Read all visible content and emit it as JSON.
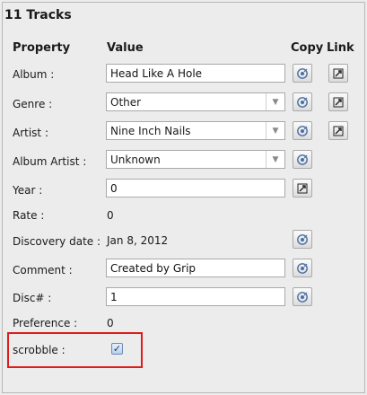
{
  "panel": {
    "title": "11 Tracks"
  },
  "headers": {
    "property": "Property",
    "value": "Value",
    "copy": "Copy",
    "link": "Link"
  },
  "fields": {
    "album": {
      "label": "Album :",
      "value": "Head Like A Hole"
    },
    "genre": {
      "label": "Genre :",
      "value": "Other"
    },
    "artist": {
      "label": "Artist :",
      "value": "Nine Inch Nails"
    },
    "album_artist": {
      "label": "Album Artist :",
      "value": "Unknown"
    },
    "year": {
      "label": "Year :",
      "value": "0"
    },
    "rate": {
      "label": "Rate :",
      "value": "0"
    },
    "discovery_date": {
      "label": "Discovery date :",
      "value": "Jan 8, 2012"
    },
    "comment": {
      "label": "Comment :",
      "value": "Created by Grip"
    },
    "disc": {
      "label": "Disc# :",
      "value": "1"
    },
    "preference": {
      "label": "Preference :",
      "value": "0"
    },
    "scrobble": {
      "label": "scrobble :",
      "checked": true
    }
  },
  "icons": {
    "copy": "copy-icon",
    "link": "link-icon",
    "dropdown": "chevron-down-icon",
    "check": "checkmark-icon"
  },
  "colors": {
    "highlight": "#e01b1b"
  }
}
